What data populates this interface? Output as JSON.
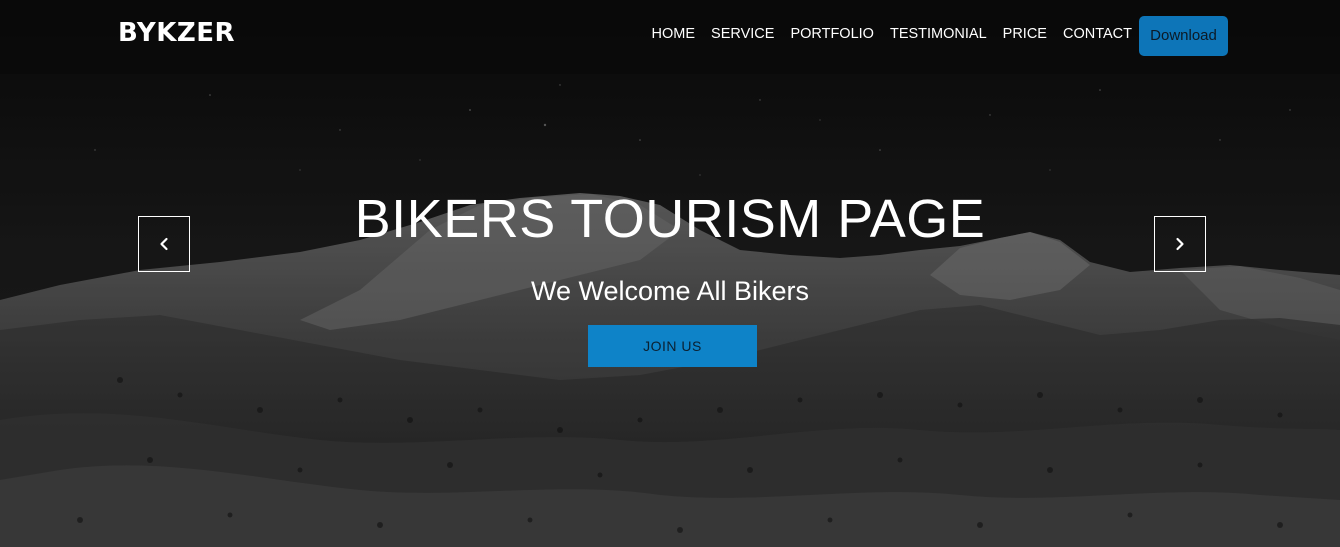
{
  "navbar": {
    "brand": "BYKZER",
    "links": [
      "HOME",
      "SERVICE",
      "PORTFOLIO",
      "TESTIMONIAL",
      "PRICE",
      "CONTACT"
    ],
    "download_label": "Download"
  },
  "hero": {
    "title": "BIKERS TOURISM PAGE",
    "subtitle": "We Welcome All Bikers",
    "join_label": "JOIN US",
    "prev_icon": "chevron-left-icon",
    "next_icon": "chevron-right-icon"
  },
  "colors": {
    "accent": "#0e83c8",
    "download": "#0d75b8",
    "text": "#ffffff"
  }
}
